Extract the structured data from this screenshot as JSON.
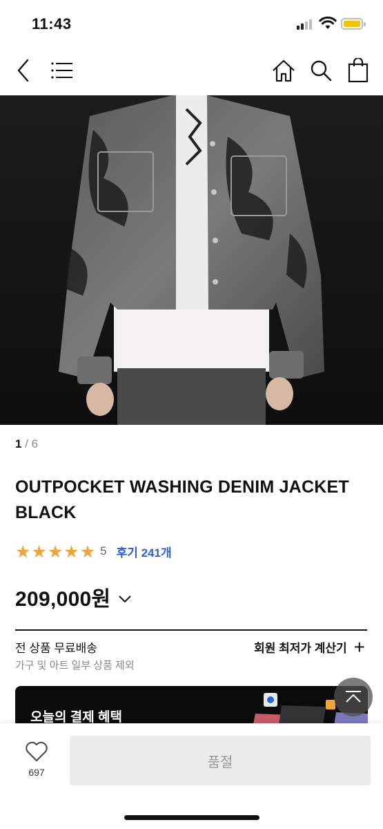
{
  "status_bar": {
    "time": "11:43"
  },
  "nav": {
    "back_icon": "chevron-left-icon",
    "menu_icon": "hamburger-menu-icon",
    "home_icon": "home-icon",
    "search_icon": "search-icon",
    "bag_icon": "shopping-bag-icon"
  },
  "gallery": {
    "current": "1",
    "separator": " / ",
    "total": "6"
  },
  "product": {
    "title": "OUTPOCKET WASHING DENIM JACKET BLACK",
    "rating_value": "5",
    "review_link": "후기 241개",
    "price": "209,000원"
  },
  "shipping": {
    "title": "전 상품 무료배송",
    "subtitle": "가구 및 아트 일부 상품 제외",
    "calculator_label": "회원 최저가 계산기"
  },
  "benefit": {
    "title": "오늘의 결제 혜택"
  },
  "bottom_bar": {
    "like_count": "697",
    "buy_button_label": "품절"
  },
  "colors": {
    "star": "#f0a53a",
    "review_link": "#2d5fd0",
    "soldout_bg": "#ececec",
    "banner_bg": "#0b0b0b"
  }
}
